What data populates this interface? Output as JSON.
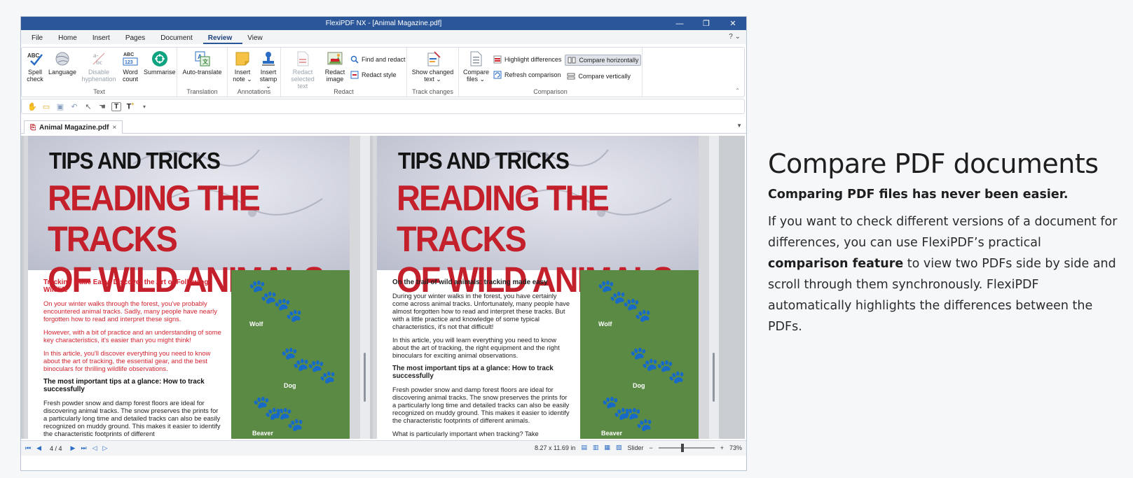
{
  "window": {
    "title": "FlexiPDF NX - [Animal Magazine.pdf]",
    "minimize": "—",
    "restore": "❐",
    "close": "✕"
  },
  "menu": {
    "items": [
      "File",
      "Home",
      "Insert",
      "Pages",
      "Document",
      "Review",
      "View"
    ],
    "active": "Review",
    "help": "? ⌄"
  },
  "ribbon": {
    "text_group": {
      "label": "Text",
      "spell_check": "Spell check",
      "language": "Language",
      "disable_hyphenation": "Disable hyphenation",
      "word_count": "Word count",
      "summarise": "Summarise"
    },
    "translation_group": {
      "label": "Translation",
      "auto_translate": "Auto-translate"
    },
    "annotations_group": {
      "label": "Annotations",
      "insert_note": "Insert note ⌄",
      "insert_stamp": "Insert stamp ⌄"
    },
    "redact_group": {
      "label": "Redact",
      "redact_selected_text": "Redact selected text",
      "redact_image": "Redact image",
      "find_and_redact": "Find and redact",
      "redact_style": "Redact style"
    },
    "track_changes_group": {
      "label": "Track changes",
      "show_changed_text": "Show changed text ⌄"
    },
    "comparison_group": {
      "label": "Comparison",
      "compare_files": "Compare files ⌄",
      "highlight_differences": "Highlight differences",
      "refresh_comparison": "Refresh comparison",
      "compare_horizontally": "Compare horizontally",
      "compare_vertically": "Compare vertically"
    }
  },
  "document_tab": {
    "name": "Animal Magazine.pdf",
    "close": "×"
  },
  "pages": {
    "left": {
      "kicker": "TIPS AND TRICKS",
      "headline_line1": "READING THE TRACKS",
      "headline_line2": "OF WILD ANIMALS",
      "heading1": "Tracking Made Easy: Discover the Art of Following Wildlife",
      "para1": "On your winter walks through the forest, you've probably encountered animal tracks. Sadly, many people have nearly forgotten how to read and interpret these signs.",
      "para2": "However, with a bit of practice and an understanding of some key characteristics, it's easier than you might think!",
      "para3": "In this article, you'll discover everything you need to know about the art of tracking, the essential gear, and the best binoculars for thrilling wildlife observations.",
      "heading2": "The most important tips at a glance: How to track successfully",
      "para4": "Fresh powder snow and damp forest floors are ideal for discovering animal tracks. The snow preserves the prints for a particularly long time and detailed tracks can also be easily recognized on muddy ground. This makes it easier to identify the characteristic footprints of different"
    },
    "right": {
      "kicker": "TIPS AND TRICKS",
      "headline_line1": "READING THE TRACKS",
      "headline_line2": "OF WILD ANIMALS",
      "heading1": "On the trail of wild animals: tracking made easy",
      "para1": "During your winter walks in the forest, you have certainly come across animal tracks. Unfortunately, many people have almost forgotten how to read and interpret these tracks. But with a little practice and knowledge of some typical characteristics, it's not that difficult!",
      "para2": "In this article, you will learn everything you need to know about the art of tracking, the right equipment and the right binoculars for exciting animal observations.",
      "heading2": "The most important tips at a glance: How to track successfully",
      "para3": "Fresh powder snow and damp forest floors are ideal for discovering animal tracks. The snow preserves the prints for a particularly long time and detailed tracks can also be easily recognized on muddy ground. This makes it easier to identify the characteristic footprints of different animals.",
      "para4": "What is particularly important when tracking? Take"
    },
    "animals": [
      "Wolf",
      "Dog",
      "Beaver"
    ]
  },
  "status": {
    "page": "4 / 4",
    "page_size": "8.27 x 11.69 in",
    "zoom_mode": "Slider",
    "zoom_out": "−",
    "zoom_in": "+",
    "zoom": "73%"
  },
  "copy": {
    "title": "Compare PDF documents",
    "subtitle": "Comparing PDF files has never been easier.",
    "body_before": "If you want to check different versions of a document for differences, you can use FlexiPDF’s practical ",
    "body_bold": "comparison feature",
    "body_after": " to view two PDFs side by side and scroll through them synchronously. FlexiPDF automatically highlights the differences between the PDFs."
  }
}
